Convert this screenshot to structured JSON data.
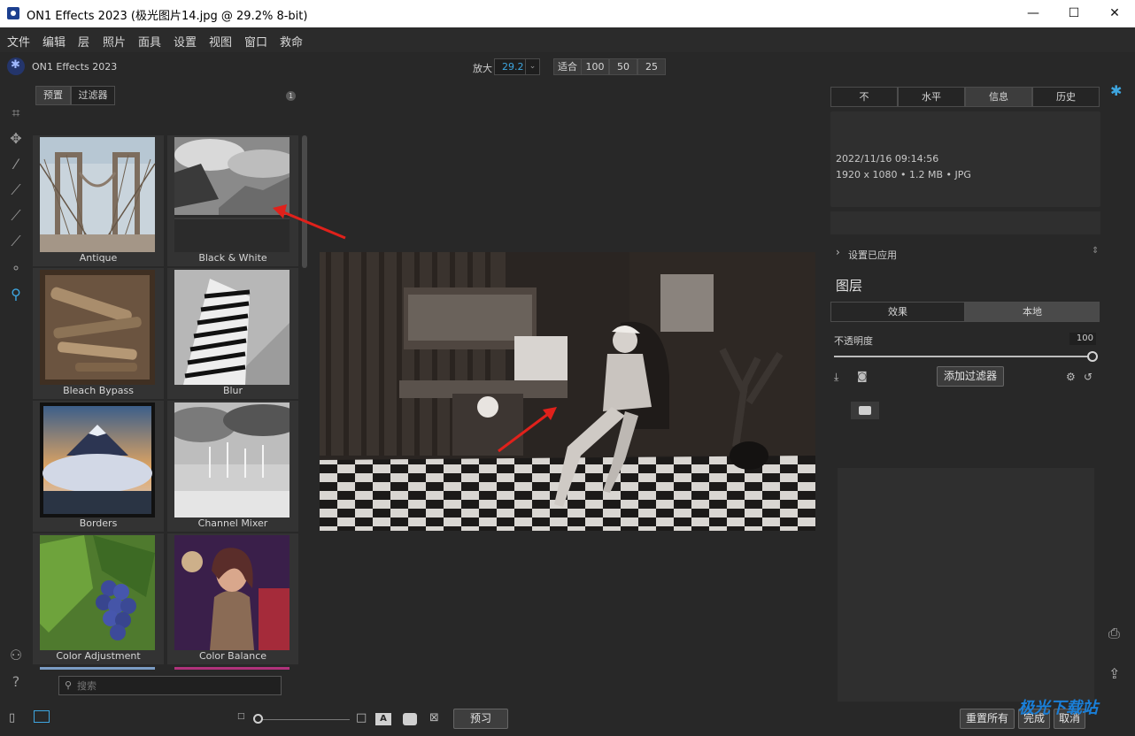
{
  "window": {
    "title": "ON1 Effects 2023 (极光图片14.jpg @ 29.2% 8-bit)",
    "minimize": "—",
    "maximize": "☐",
    "close": "✕"
  },
  "menu": [
    "文件",
    "编辑",
    "层",
    "照片",
    "面具",
    "设置",
    "视图",
    "窗口",
    "救命"
  ],
  "app_name": "ON1 Effects 2023",
  "zoom": {
    "label": "放大",
    "value": "29.2",
    "fit": "适合",
    "presets": [
      "100",
      "50",
      "25"
    ]
  },
  "browser": {
    "tabs": [
      "预置",
      "过滤器"
    ],
    "info": "1",
    "items": [
      {
        "label": "Antique"
      },
      {
        "label": "Black & White"
      },
      {
        "label": "Bleach Bypass"
      },
      {
        "label": "Blur"
      },
      {
        "label": "Borders"
      },
      {
        "label": "Channel Mixer"
      },
      {
        "label": "Color Adjustment"
      },
      {
        "label": "Color Balance"
      }
    ],
    "search_placeholder": "搜索"
  },
  "right_panel": {
    "tabs": [
      "不",
      "水平",
      "信息",
      "历史"
    ],
    "active_tab": "信息",
    "info_date": "2022/11/16  09:14:56",
    "info_meta": "1920 x 1080 • 1.2 MB • JPG",
    "settings_applied": "设置已应用",
    "layers_title": "图层",
    "layer_tabs": [
      "效果",
      "本地"
    ],
    "active_layer_tab": "本地",
    "opacity_label": "不透明度",
    "opacity_value": "100",
    "add_filter": "添加过滤器"
  },
  "bottom": {
    "preview": "预习",
    "reset_all": "重置所有",
    "done": "完成",
    "cancel": "取消"
  },
  "watermark": "极光下载站",
  "colors": {
    "accent": "#3ea6e0",
    "background": "#282828",
    "annotation_arrow": "#e0211b"
  },
  "icons": [
    "crop-icon",
    "move-icon",
    "magic-wand-icon",
    "brush-icon",
    "masking-brush-icon",
    "refine-brush-icon",
    "retouch-icon",
    "zoom-hand-icon",
    "account-icon",
    "help-icon",
    "print-icon",
    "share-icon"
  ]
}
